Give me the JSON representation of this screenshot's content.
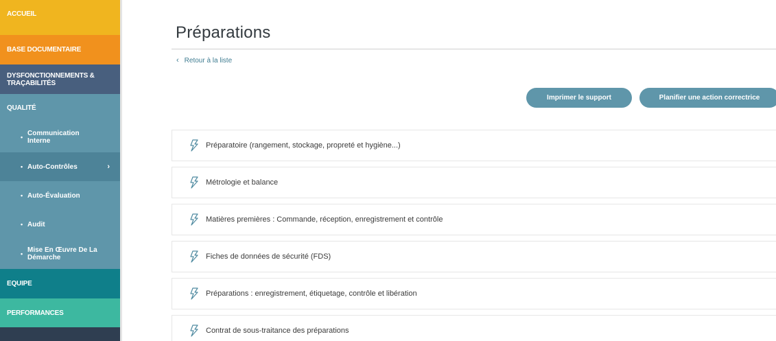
{
  "sidebar": {
    "items": [
      {
        "label": "ACCUEIL",
        "color": "#f0b51f"
      },
      {
        "label": "BASE DOCUMENTAIRE",
        "color": "#f1911d"
      },
      {
        "label": "DYSFONCTIONNEMENTS & TRAÇABILITÉS",
        "color": "#485f7e"
      },
      {
        "label": "QUALITÉ",
        "color": "#5f96aa"
      },
      {
        "label": "EQUIPE",
        "color": "#0f7f8a"
      },
      {
        "label": "PERFORMANCES",
        "color": "#3db8a0"
      }
    ],
    "sub_items": [
      {
        "label": "Communication Interne"
      },
      {
        "label": "Auto-Contrôles",
        "active": true
      },
      {
        "label": "Auto-Évaluation"
      },
      {
        "label": "Audit"
      },
      {
        "label": "Mise En Œuvre De La Démarche"
      }
    ],
    "footer_color": "#2f3e51"
  },
  "main": {
    "title": "Préparations",
    "back_link": "Retour à la liste",
    "buttons": {
      "print": "Imprimer le support",
      "plan": "Planifier une action correctrice"
    },
    "rows": [
      {
        "label": "Préparatoire (rangement, stockage, propreté et hygiène...)"
      },
      {
        "label": "Métrologie et balance"
      },
      {
        "label": "Matières premières : Commande, réception, enregistrement et contrôle"
      },
      {
        "label": "Fiches de données de sécurité (FDS)"
      },
      {
        "label": "Préparations : enregistrement, étiquetage, contrôle et libération"
      },
      {
        "label": "Contrat de sous-traitance des préparations"
      }
    ]
  }
}
